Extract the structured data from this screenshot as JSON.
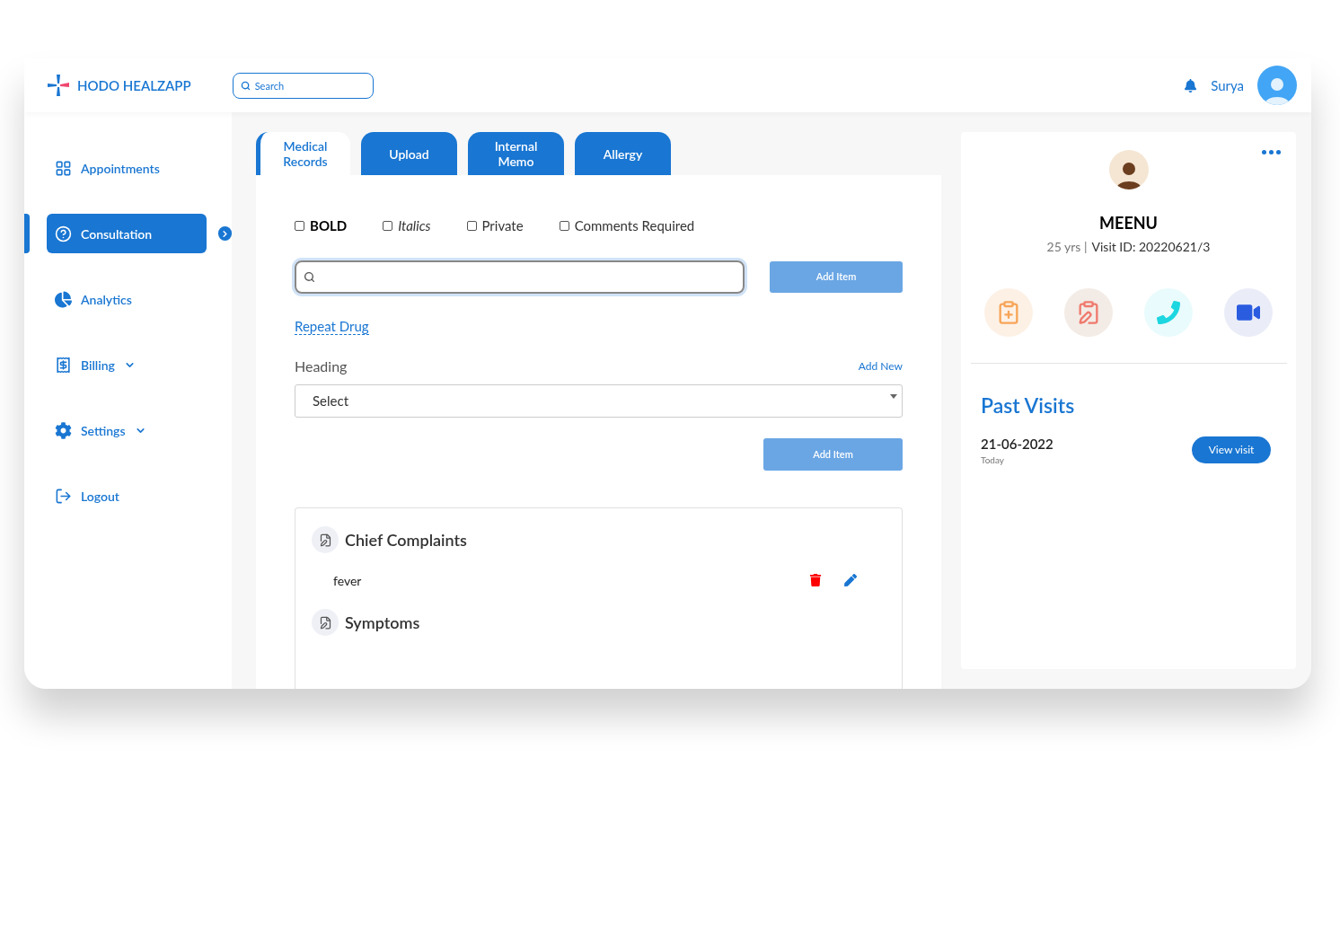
{
  "header": {
    "logo_text": "HODO HEALZAPP",
    "search": {
      "placeholder": "Search"
    },
    "user_name": "Surya"
  },
  "sidebar": {
    "items": [
      {
        "label": "Appointments",
        "selected": false,
        "expandable": false
      },
      {
        "label": "Consultation",
        "selected": true,
        "expandable": false
      },
      {
        "label": "Analytics",
        "selected": false,
        "expandable": false
      },
      {
        "label": "Billing",
        "selected": false,
        "expandable": true
      },
      {
        "label": "Settings",
        "selected": false,
        "expandable": true
      },
      {
        "label": "Logout",
        "selected": false,
        "expandable": false
      }
    ]
  },
  "tabs": [
    {
      "label": "Medical Records",
      "selected": true
    },
    {
      "label": "Upload",
      "selected": false
    },
    {
      "label": "Internal Memo",
      "selected": false
    },
    {
      "label": "Allergy",
      "selected": false
    }
  ],
  "options": [
    {
      "label": "BOLD",
      "checked": false,
      "kind": "bold"
    },
    {
      "label": "Italics",
      "checked": false,
      "kind": "italic"
    },
    {
      "label": "Private",
      "checked": false,
      "kind": "plain"
    },
    {
      "label": "Comments Required",
      "checked": false,
      "kind": "plain"
    }
  ],
  "item_search": {
    "button": "Add Item"
  },
  "repeat_drug": "Repeat Drug",
  "heading": {
    "label": "Heading",
    "add_new": "Add New",
    "select_value": "Select",
    "button": "Add Item"
  },
  "sections": [
    {
      "title": "Chief Complaints",
      "items": [
        {
          "text": "fever"
        }
      ]
    },
    {
      "title": "Symptoms"
    }
  ],
  "patient": {
    "name": "MEENU",
    "age": "25 yrs |",
    "visit_id": "Visit ID: 20220621/3"
  },
  "past_visits": {
    "title": "Past Visits",
    "visits": [
      {
        "date": "21-06-2022",
        "note": "Today",
        "button": "View visit"
      }
    ]
  }
}
